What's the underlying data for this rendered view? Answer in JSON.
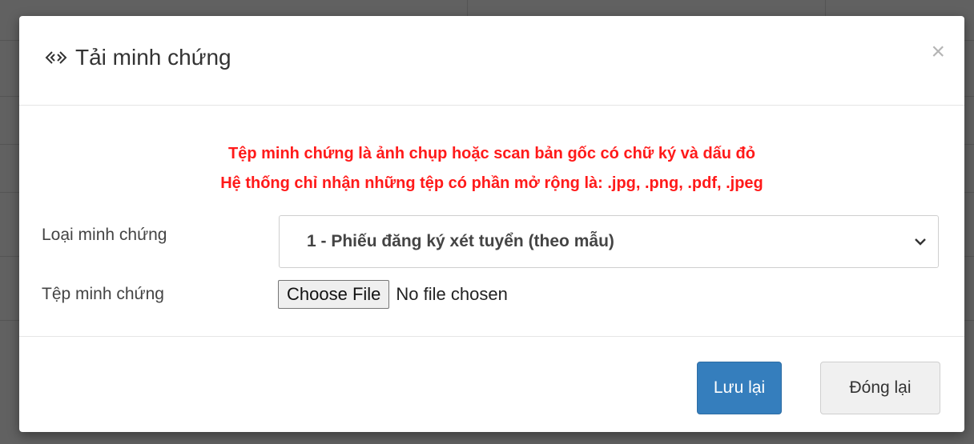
{
  "modal": {
    "title": "Tải minh chứng",
    "close_symbol": "×",
    "title_icon": "link-icon",
    "notice_lines": [
      "Tệp minh chứng là ảnh chụp hoặc scan bản gốc có chữ ký và dấu đỏ",
      "Hệ thống chỉ nhận những tệp có phần mở rộng là: .jpg, .png, .pdf, .jpeg"
    ],
    "notice_color": "#ff1a1a",
    "form": {
      "type_label": "Loại minh chứng",
      "type_selected": "1 - Phiếu đăng ký xét tuyển (theo mẫu)",
      "file_label": "Tệp minh chứng",
      "file_button": "Choose File",
      "file_status": "No file chosen"
    },
    "buttons": {
      "save": "Lưu lại",
      "close": "Đóng lại"
    },
    "primary_color": "#357ebd"
  }
}
